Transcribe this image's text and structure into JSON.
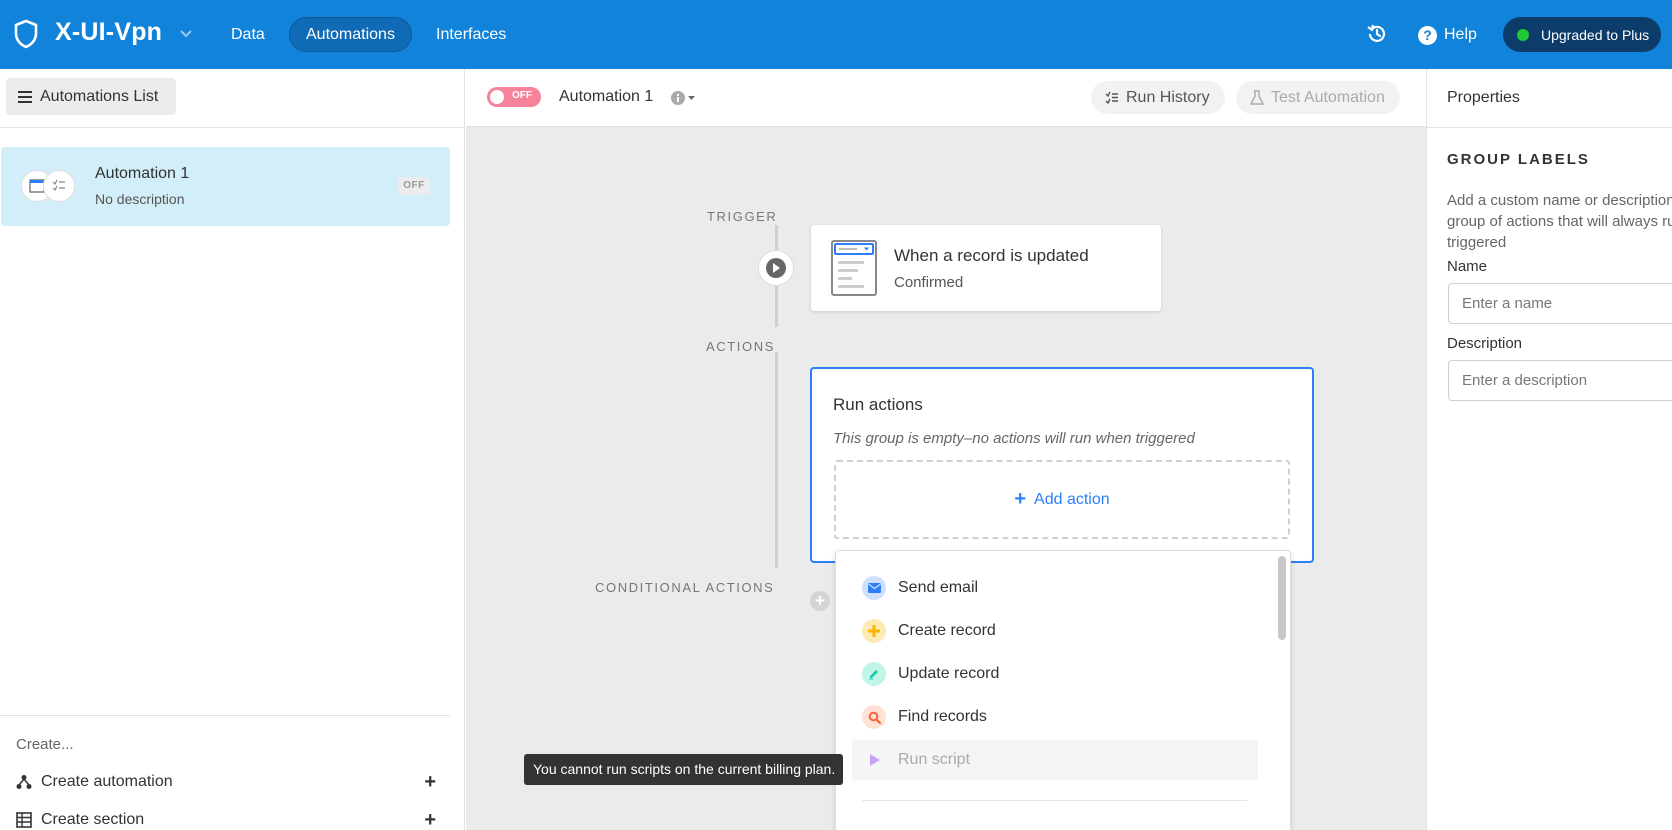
{
  "topbar": {
    "base_name": "X-UI-Vpn",
    "nav": [
      "Data",
      "Automations",
      "Interfaces"
    ],
    "help_label": "Help",
    "plan_label": "Upgraded to Plus",
    "brand_color": "#1283da",
    "plan_dot_color": "#20c933"
  },
  "left": {
    "list_button": "Automations List",
    "automation": {
      "name": "Automation 1",
      "description": "No description",
      "status": "OFF"
    },
    "create_label": "Create...",
    "create_automation": "Create automation",
    "create_section": "Create section"
  },
  "center": {
    "toggle_label": "OFF",
    "title": "Automation 1",
    "run_history": "Run History",
    "test_automation": "Test Automation",
    "trigger_label": "TRIGGER",
    "actions_label": "ACTIONS",
    "conditional_label": "CONDITIONAL ACTIONS",
    "trigger_card": {
      "title": "When a record is updated",
      "subtitle": "Confirmed"
    },
    "actions_card": {
      "title": "Run actions",
      "empty_text": "This group is empty–no actions will run when triggered",
      "add_action": "Add action"
    },
    "dropdown": [
      {
        "label": "Send email",
        "icon": "envelope-icon",
        "color": "#2d7ff9"
      },
      {
        "label": "Create record",
        "icon": "plus-icon",
        "color": "#fcb400"
      },
      {
        "label": "Update record",
        "icon": "pencil-icon",
        "color": "#20c9b0"
      },
      {
        "label": "Find records",
        "icon": "search-icon",
        "color": "#f7653b"
      },
      {
        "label": "Run script",
        "icon": "play-icon",
        "color": "#b57cf5"
      }
    ],
    "tooltip": "You cannot run scripts on the current billing plan."
  },
  "right": {
    "header": "Properties",
    "group_labels": "GROUP LABELS",
    "description": "Add a custom name or description for this group of actions that will always run when triggered",
    "name_label": "Name",
    "name_placeholder": "Enter a name",
    "description_label": "Description",
    "description_placeholder": "Enter a description"
  }
}
